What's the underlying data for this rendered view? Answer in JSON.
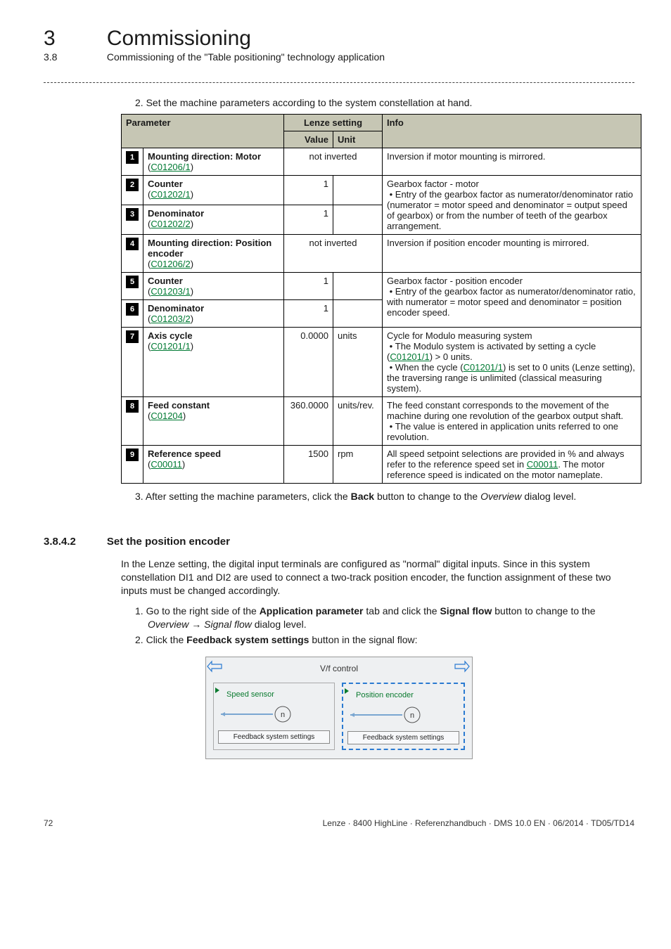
{
  "chapter": {
    "num": "3",
    "title": "Commissioning"
  },
  "section": {
    "num": "3.8",
    "title": "Commissioning of the \"Table positioning\" technology application"
  },
  "step2": {
    "num": "2.",
    "text": "Set the machine parameters according to the system constellation at hand."
  },
  "table": {
    "h_param": "Parameter",
    "h_lenze": "Lenze setting",
    "h_info": "Info",
    "h_value": "Value",
    "h_unit": "Unit",
    "rows": [
      {
        "n": "1",
        "name": "Mounting direction: Motor",
        "code": "C01206/1",
        "value": "not inverted",
        "unit": "",
        "span_value_unit": true,
        "info": "Inversion if motor mounting is mirrored."
      },
      {
        "n": "2",
        "name": "Counter",
        "code": "C01202/1",
        "value": "1",
        "unit": "",
        "info_top": "Gearbox factor - motor",
        "info_li": "Entry of the gearbox factor as numerator/denominator ratio (numerator = motor speed and denominator = output speed of gearbox) or from the number of teeth of the gearbox arrangement.",
        "info_rowspan": 2
      },
      {
        "n": "3",
        "name": "Denominator",
        "code": "C01202/2",
        "value": "1",
        "unit": "",
        "info_continued": true
      },
      {
        "n": "4",
        "name": "Mounting direction: Position encoder",
        "code": "C01206/2",
        "value": "not inverted",
        "unit": "",
        "span_value_unit": true,
        "info": "Inversion if position encoder mounting is mirrored."
      },
      {
        "n": "5",
        "name": "Counter",
        "code": "C01203/1",
        "value": "1",
        "unit": "",
        "info_top": "Gearbox factor - position encoder",
        "info_li": "Entry of the gearbox factor as numerator/denominator ratio, with numerator = motor speed and denominator = position encoder speed.",
        "info_rowspan": 2
      },
      {
        "n": "6",
        "name": "Denominator",
        "code": "C01203/2",
        "value": "1",
        "unit": "",
        "info_continued": true
      },
      {
        "n": "7",
        "name": "Axis cycle",
        "code": "C01201/1",
        "value": "0.0000",
        "unit": "units",
        "info_top": "Cycle for Modulo measuring system",
        "info_li1_pre": "The Modulo system is activated by setting a cycle (",
        "info_li1_link": "C01201/1",
        "info_li1_post": ") > 0 units.",
        "info_li2_pre": "When the cycle (",
        "info_li2_link": "C01201/1",
        "info_li2_post": ") is set to 0 units (Lenze setting), the traversing range is unlimited (classical measuring system)."
      },
      {
        "n": "8",
        "name": "Feed constant",
        "code": "C01204",
        "value": "360.0000",
        "unit": "units/rev.",
        "info_top": "The feed constant corresponds to the movement of the machine during one revolution of the gearbox output shaft.",
        "info_li": "The value is entered in application units referred to one revolution."
      },
      {
        "n": "9",
        "name": "Reference speed",
        "code": "C00011",
        "value": "1500",
        "unit": "rpm",
        "info_pre": "All speed setpoint selections are provided in % and always refer to the reference speed set in ",
        "info_link": "C00011",
        "info_post": ". The motor reference speed is indicated on the motor nameplate."
      }
    ]
  },
  "step3": {
    "num": "3.",
    "pre": "After setting the machine parameters, click the ",
    "bold": "Back",
    "mid": " button to change to the ",
    "ital": "Overview",
    "post": " dialog level."
  },
  "sub": {
    "num": "3.8.4.2",
    "title": "Set the position encoder"
  },
  "intro": "In the Lenze setting, the digital input terminals are configured as \"normal\" digital inputs. Since in this system constellation DI1 and DI2 are used to connect a two-track position encoder, the function assignment of these two inputs must be changed accordingly.",
  "enclist": {
    "i1": {
      "num": "1.",
      "pre": "Go to the right side of the ",
      "b1": "Application parameter",
      "mid": " tab and click the ",
      "b2": "Signal flow",
      "mid2": " button to change to the ",
      "ital1": "Overview",
      "arrow": " → ",
      "ital2": "Signal flow",
      "post": " dialog level."
    },
    "i2": {
      "num": "2.",
      "pre": "Click the ",
      "b1": "Feedback system settings",
      "post": " button in the signal flow:"
    }
  },
  "panel": {
    "title": "V/f control",
    "left": {
      "label": "Speed sensor",
      "btn": "Feedback system settings"
    },
    "right": {
      "label": "Position encoder",
      "btn": "Feedback system settings"
    }
  },
  "footer": {
    "page": "72",
    "doc": "Lenze · 8400 HighLine · Referenzhandbuch · DMS 10.0 EN · 06/2014 · TD05/TD14"
  }
}
